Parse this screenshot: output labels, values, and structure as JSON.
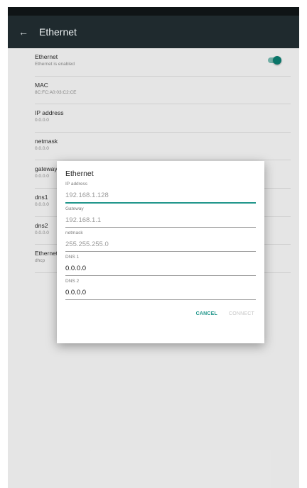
{
  "header": {
    "title": "Ethernet"
  },
  "list": [
    {
      "title": "Ethernet",
      "value": "Ethernet is enabled"
    },
    {
      "title": "MAC",
      "value": "8C:FC:A0:03:C2:CE"
    },
    {
      "title": "IP address",
      "value": "0.0.0.0"
    },
    {
      "title": "netmask",
      "value": "0.0.0.0"
    },
    {
      "title": "gateway",
      "value": "0.0.0.0"
    },
    {
      "title": "dns1",
      "value": "0.0.0.0"
    },
    {
      "title": "dns2",
      "value": "0.0.0.0"
    },
    {
      "title": "Ethernet",
      "value": "dhcp"
    }
  ],
  "dialog": {
    "title": "Ethernet",
    "fields": [
      {
        "label": "IP address",
        "placeholder": "192.168.1.128",
        "value": ""
      },
      {
        "label": "Gateway",
        "placeholder": "192.168.1.1",
        "value": ""
      },
      {
        "label": "netmask",
        "placeholder": "255.255.255.0",
        "value": ""
      },
      {
        "label": "DNS 1",
        "placeholder": "",
        "value": "0.0.0.0"
      },
      {
        "label": "DNS 2",
        "placeholder": "",
        "value": "0.0.0.0"
      }
    ],
    "cancel_label": "CANCEL",
    "connect_label": "CONNECT"
  },
  "colors": {
    "accent": "#21968b",
    "appbar": "#1f2a2e",
    "toggle_on": "#0b7d70"
  }
}
